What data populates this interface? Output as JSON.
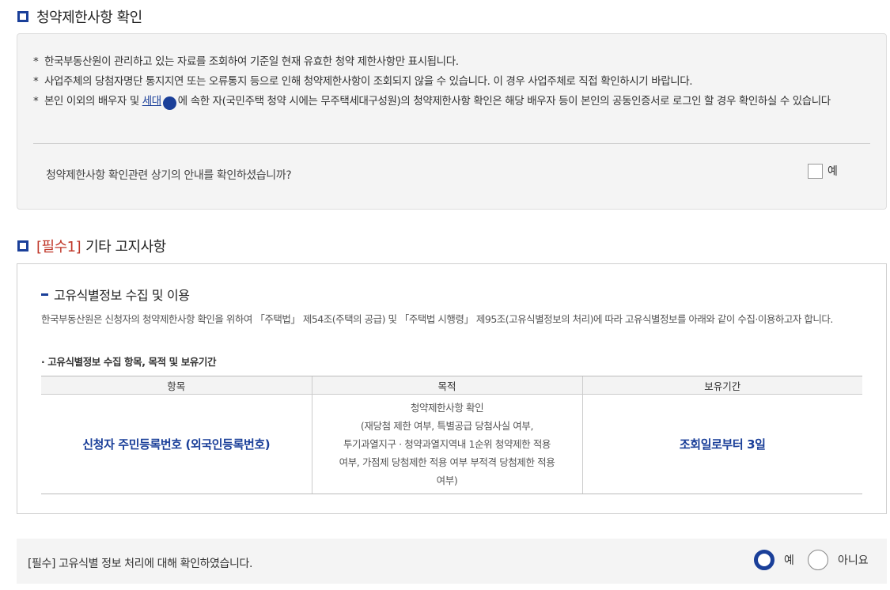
{
  "section1": {
    "title": "청약제한사항 확인",
    "notes": [
      "한국부동산원이 관리하고 있는 자료를 조회하여 기준일 현재 유효한 청약 제한사항만 표시됩니다.",
      "사업주체의 당첨자명단 통지지연 또는 오류통지 등으로 인해 청약제한사항이 조회되지 않을 수 있습니다. 이 경우 사업주체로 직접 확인하시기 바랍니다."
    ],
    "note3_prefix": "본인 이외의 배우자 및 ",
    "note3_link": "세대",
    "note3_help": "?",
    "note3_suffix": "에 속한 자(국민주택 청약 시에는 무주택세대구성원)의 청약제한사항 확인은 해당 배우자 등이 본인의 공동인증서로 로그인 할 경우 확인하실 수 있습니다",
    "confirm_question": "청약제한사항 확인관련 상기의 안내를 확인하셨습니까?",
    "confirm_label": "예",
    "confirm_checked": false
  },
  "section2": {
    "required_tag": "[필수1]",
    "title": "기타 고지사항",
    "sub_title": "고유식별정보 수집 및 이용",
    "description": "한국부동산원은 신청자의 청약제한사항 확인을 위하여 「주택법」 제54조(주택의 공급) 및 「주택법 시행령」 제95조(고유식별정보의 처리)에 따라 고유식별정보를 아래와 같이 수집·이용하고자 합니다.",
    "list_heading": "· 고유식별정보 수집 항목, 목적 및 보유기간",
    "table": {
      "headers": [
        "항목",
        "목적",
        "보유기간"
      ],
      "item": "신청자 주민등록번호 (외국인등록번호)",
      "purpose_lines": [
        "청약제한사항 확인",
        "(재당첨 제한 여부, 특별공급 당첨사실 여부,",
        "투기과열지구 · 청약과열지역내 1순위 청약제한 적용",
        "여부, 가점제 당첨제한 적용 여부 부적격 당첨제한 적용",
        "여부)"
      ],
      "period": "조회일로부터 3일"
    }
  },
  "section3": {
    "question": "[필수] 고유식별 정보 처리에 대해 확인하였습니다.",
    "yes_label": "예",
    "no_label": "아니요",
    "selected": "yes"
  },
  "colors": {
    "accent": "#1a3f99",
    "required": "#c0392b",
    "panel": "#f4f4f4"
  }
}
